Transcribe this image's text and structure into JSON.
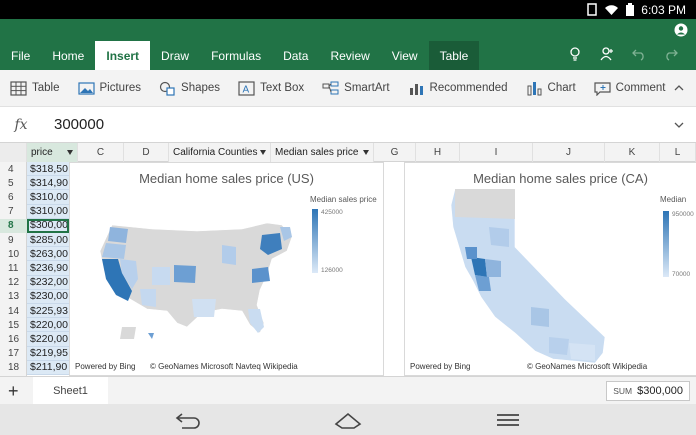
{
  "status": {
    "time": "6:03 PM"
  },
  "ribbon": {
    "tabs": [
      "File",
      "Home",
      "Insert",
      "Draw",
      "Formulas",
      "Data",
      "Review",
      "View",
      "Table"
    ],
    "active_tab": "Insert"
  },
  "toolbar": {
    "items": [
      {
        "label": "Table",
        "icon": "table-icon"
      },
      {
        "label": "Pictures",
        "icon": "pictures-icon"
      },
      {
        "label": "Shapes",
        "icon": "shapes-icon"
      },
      {
        "label": "Text Box",
        "icon": "text-box-icon"
      },
      {
        "label": "SmartArt",
        "icon": "smartart-icon"
      },
      {
        "label": "Recommended",
        "icon": "recommended-icon"
      },
      {
        "label": "Chart",
        "icon": "chart-icon"
      },
      {
        "label": "Comment",
        "icon": "comment-icon"
      }
    ]
  },
  "formula": {
    "fx": "fx",
    "value": "300000"
  },
  "columns": {
    "b_header": "price",
    "c": "C",
    "d": "D",
    "e_header": "California Counties",
    "f_header": "Median sales price",
    "g": "G",
    "h": "H",
    "i": "I",
    "j": "J",
    "k": "K",
    "l": "L"
  },
  "rows": {
    "numbers": [
      "4",
      "5",
      "6",
      "7",
      "8",
      "9",
      "10",
      "11",
      "12",
      "13",
      "14",
      "15",
      "16",
      "17",
      "18"
    ],
    "values": [
      "$318,50",
      "$314,90",
      "$310,00",
      "$310,00",
      "$300,00",
      "$285,00",
      "$263,00",
      "$236,90",
      "$232,00",
      "$230,00",
      "$225,93",
      "$220,00",
      "$220,00",
      "$219,95",
      "$211,90"
    ],
    "selected_index": 4
  },
  "chart_us": {
    "title": "Median home sales price (US)",
    "legend_title": "Median sales price",
    "legend_max": "425000",
    "legend_min": "126000",
    "footer_left": "Powered by Bing",
    "footer_right": "© GeoNames Microsoft Navteq Wikipedia"
  },
  "chart_ca": {
    "title": "Median home sales price (CA)",
    "legend_title": "Median",
    "legend_max": "950000",
    "legend_min": "70000",
    "footer_left": "Powered by Bing",
    "footer_right": "© GeoNames Microsoft Wikipedia"
  },
  "sheet": {
    "tab_name": "Sheet1",
    "add_label": "+"
  },
  "sum": {
    "label": "SUM",
    "value": "$300,000"
  },
  "colors": {
    "brand": "#217346",
    "map_dark": "#2e75b6",
    "map_light": "#dce9f7",
    "map_gray": "#d9d9d9"
  }
}
